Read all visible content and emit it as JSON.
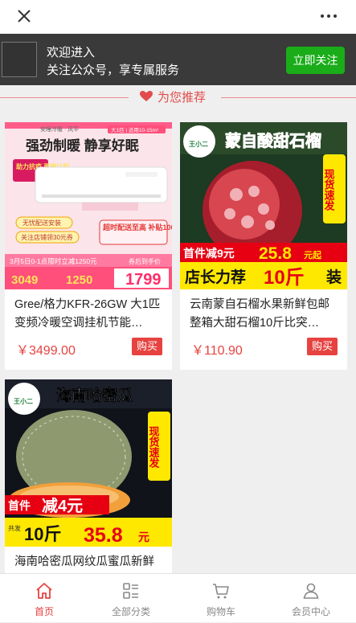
{
  "topbar": {
    "close_icon": "close-icon",
    "more_icon": "more-dots-icon"
  },
  "follow_banner": {
    "line1": "欢迎进入",
    "line2": "关注公众号，享专属服务",
    "button": "立即关注",
    "button_color": "#1aad19"
  },
  "section": {
    "title": "为您推荐",
    "icon": "heart-icon",
    "color": "#e14b4b"
  },
  "products": [
    {
      "name": "Gree/格力KFR-26GW 大1匹变频冷暖空调挂机节能…",
      "price": "￥3499.00",
      "buy": "购买",
      "image": {
        "top_small": "安睡冷暖 · 风平",
        "tag": "大1匹 | 适用10-15m²",
        "headline": "强劲制暖  静享好眠",
        "badge": "助力抗疫 再据让利",
        "bullet1": "无忧配送安装",
        "bullet2": "关注店铺领30元券",
        "promo": "超时配送至高 补贴100元",
        "strip": "3月5日0-1点限时立减1250元",
        "strip_right": "券后到手价",
        "p1": "3049",
        "p2": "1250",
        "p3": "1799"
      }
    },
    {
      "name": "云南蒙自石榴水果新鲜包邮整箱大甜石榴10斤比突…",
      "price": "￥110.90",
      "buy": "购买",
      "image": {
        "headline": "蒙自酸甜石榴",
        "logo": "王小二",
        "side": "现货速发",
        "promo_left": "首件减9元",
        "promo_num": "25.8",
        "promo_unit": "元起",
        "bottom": "店长力荐",
        "bottom_big": "10斤",
        "bottom_tail": "装"
      }
    },
    {
      "name": "海南哈密瓜网纹瓜蜜瓜新鲜",
      "price": "",
      "buy": "",
      "image": {
        "headline": "海南哈密瓜",
        "logo": "王小二",
        "side": "现货速发",
        "promo_left": "首件",
        "promo_big": "减4元",
        "total_small": "共发",
        "total": "10斤",
        "total_price": "35.8",
        "total_unit": "元"
      }
    }
  ],
  "bottom_nav": [
    {
      "label": "首页",
      "icon": "home-icon",
      "active": true
    },
    {
      "label": "全部分类",
      "icon": "category-icon",
      "active": false
    },
    {
      "label": "购物车",
      "icon": "cart-icon",
      "active": false
    },
    {
      "label": "会员中心",
      "icon": "user-icon",
      "active": false
    }
  ]
}
